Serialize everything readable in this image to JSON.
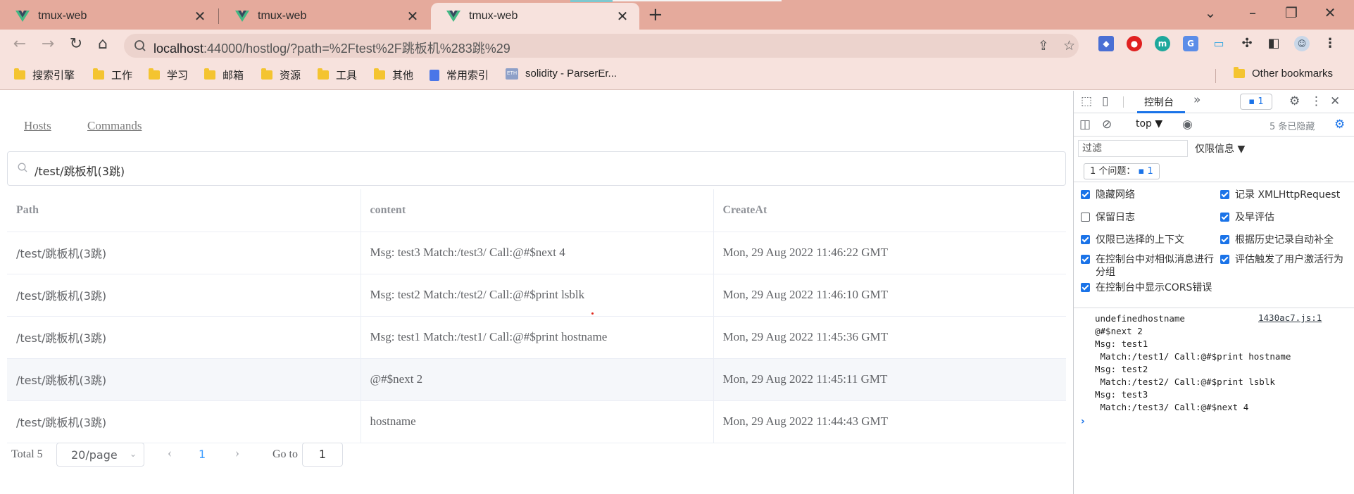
{
  "browser": {
    "tabs": [
      {
        "title": "tmux-web",
        "active": false
      },
      {
        "title": "tmux-web",
        "active": false
      },
      {
        "title": "tmux-web",
        "active": true
      }
    ],
    "url_host": "localhost",
    "url_rest": ":44000/hostlog/?path=%2Ftest%2F跳板机%283跳%29",
    "bookmarks": [
      "搜索引擎",
      "工作",
      "学习",
      "邮箱",
      "资源",
      "工具",
      "其他",
      "常用索引",
      "solidity - ParserEr..."
    ],
    "other_bookmarks": "Other bookmarks",
    "icons": {
      "back": "arrow-left-icon",
      "forward": "arrow-right-icon",
      "reload": "reload-icon",
      "home": "home-icon",
      "share": "share-icon",
      "star": "star-icon",
      "extensions": "puzzle-icon",
      "profile": "avatar-icon",
      "menu": "kebab-menu-icon"
    },
    "colors": {
      "tabbar": "#e5aa9c",
      "toolbar": "#f7e2dd",
      "vue": "#42b883"
    }
  },
  "app": {
    "nav": {
      "hosts": "Hosts",
      "commands": "Commands"
    },
    "search": {
      "value": "/test/跳板机(3跳)"
    },
    "table": {
      "headers": [
        "Path",
        "content",
        "CreateAt"
      ],
      "rows": [
        {
          "path": "/test/跳板机(3跳)",
          "content": "Msg: test3 Match:/test3/ Call:@#$next 4",
          "created": "Mon, 29 Aug 2022 11:46:22 GMT"
        },
        {
          "path": "/test/跳板机(3跳)",
          "content": "Msg: test2 Match:/test2/ Call:@#$print lsblk",
          "created": "Mon, 29 Aug 2022 11:46:10 GMT"
        },
        {
          "path": "/test/跳板机(3跳)",
          "content": "Msg: test1 Match:/test1/ Call:@#$print hostname",
          "created": "Mon, 29 Aug 2022 11:45:36 GMT"
        },
        {
          "path": "/test/跳板机(3跳)",
          "content": "@#$next 2",
          "created": "Mon, 29 Aug 2022 11:45:11 GMT"
        },
        {
          "path": "/test/跳板机(3跳)",
          "content": "hostname",
          "created": "Mon, 29 Aug 2022 11:44:43 GMT"
        }
      ]
    },
    "pagination": {
      "total": "Total 5",
      "page_size": "20/page",
      "current_page": "1",
      "goto_label": "Go to",
      "goto_value": "1"
    },
    "colors": {
      "accent": "#409eff"
    }
  },
  "devtools": {
    "tab": "控制台",
    "issues_badge": "1",
    "context": "top",
    "hidden_count": "5 条已隐藏",
    "filter_placeholder": "过滤",
    "levels": "仅限信息 ▼",
    "issues_text": "1 个问题：",
    "issues_count": "1",
    "settings": [
      {
        "label": "隐藏网络",
        "checked": true
      },
      {
        "label": "记录 XMLHttpRequest",
        "checked": true
      },
      {
        "label": "保留日志",
        "checked": false
      },
      {
        "label": "及早评估",
        "checked": true
      },
      {
        "label": "仅限已选择的上下文",
        "checked": true
      },
      {
        "label": "根据历史记录自动补全",
        "checked": true
      },
      {
        "label": "在控制台中对相似消息进行分组",
        "checked": true
      },
      {
        "label": "评估触发了用户激活行为",
        "checked": true
      },
      {
        "label": "在控制台中显示CORS错误",
        "checked": true
      }
    ],
    "console_log": "undefinedhostname\n@#$next 2\nMsg: test1\n Match:/test1/ Call:@#$print hostname\nMsg: test2\n Match:/test2/ Call:@#$print lsblk\nMsg: test3\n Match:/test3/ Call:@#$next 4",
    "console_source": "1430ac7.js:1",
    "colors": {
      "accent": "#1a73e8"
    }
  }
}
